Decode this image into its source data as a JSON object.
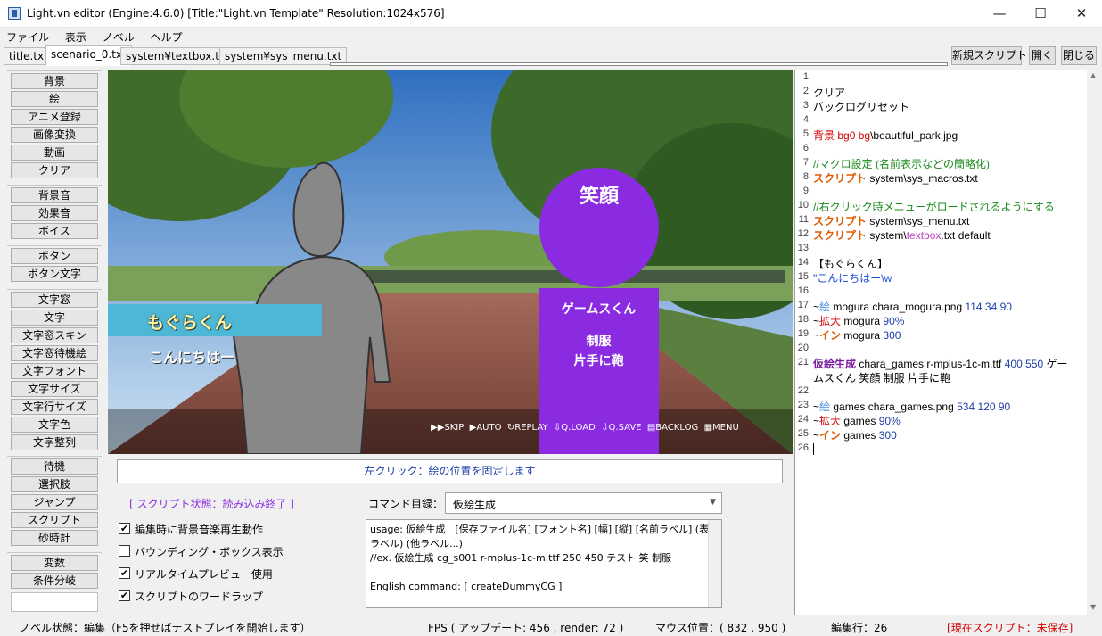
{
  "window": {
    "title": "Light.vn editor (Engine:4.6.0) [Title:\"Light.vn Template\" Resolution:1024x576]",
    "minimize": "—",
    "maximize": "☐",
    "close": "✕"
  },
  "menu": [
    "ファイル",
    "表示",
    "ノベル",
    "ヘルプ"
  ],
  "tabs": [
    "title.txt",
    "scenario_0.txt",
    "system¥textbox.txt",
    "system¥sys_menu.txt"
  ],
  "toolbar": {
    "new_script": "新規スクリプト",
    "open": "開く",
    "close": "閉じる"
  },
  "left_groups": [
    [
      "背景",
      "絵",
      "アニメ登録",
      "画像変換",
      "動画",
      "クリア"
    ],
    [
      "背景音",
      "効果音",
      "ボイス"
    ],
    [
      "ボタン",
      "ボタン文字"
    ],
    [
      "文字窓",
      "文字",
      "文字窓スキン",
      "文字窓待機絵",
      "文字フォント",
      "文字サイズ",
      "文字行サイズ",
      "文字色",
      "文字整列"
    ],
    [
      "待機",
      "選択肢",
      "ジャンプ",
      "スクリプト",
      "砂時計"
    ],
    [
      "変数",
      "条件分岐"
    ]
  ],
  "preview": {
    "name": "もぐらくん",
    "dialogue": "こんにちはー",
    "placeholder_face": "笑顔",
    "placeholder_name": "ゲームスくん",
    "placeholder_clothes": "制服",
    "placeholder_item": "片手に鞄",
    "menu": [
      "SKIP",
      "AUTO",
      "REPLAY",
      "Q.LOAD",
      "Q.SAVE",
      "BACKLOG",
      "MENU"
    ]
  },
  "info_bar": "左クリック：絵の位置を固定します",
  "script_state": "[ スクリプト状態：読み込み終了 ]",
  "command_label": "コマンド目録：",
  "command_selected": "仮絵生成",
  "usage": {
    "line1": "usage: 仮絵生成　[保存ファイル名] [フォント名] [幅] [縦] [名前ラベル] (表情",
    "line2": "ラベル) (他ラベル...)",
    "line3": "//ex. 仮絵生成 cg_s001 r-mplus-1c-m.ttf 250 450 テスト 笑 制服",
    "line4": "English command: [ createDummyCG ]"
  },
  "options": [
    {
      "label": "編集時に背景音楽再生動作",
      "checked": true
    },
    {
      "label": "バウンディング・ボックス表示",
      "checked": false
    },
    {
      "label": "リアルタイムプレビュー使用",
      "checked": true
    },
    {
      "label": "スクリプトのワードラップ",
      "checked": true
    }
  ],
  "code_lines": [
    {
      "n": "1",
      "parts": []
    },
    {
      "n": "2",
      "parts": [
        [
          "クリア",
          "#000000"
        ]
      ]
    },
    {
      "n": "3",
      "parts": [
        [
          "バックログリセット",
          "#000000"
        ]
      ]
    },
    {
      "n": "4",
      "parts": []
    },
    {
      "n": "5",
      "parts": [
        [
          "背景 ",
          "#d40000"
        ],
        [
          "bg0 ",
          "#d40000"
        ],
        [
          "bg",
          "#d40000"
        ],
        [
          "\\beautiful_park.jpg",
          "#000000"
        ]
      ]
    },
    {
      "n": "6",
      "parts": []
    },
    {
      "n": "7",
      "parts": [
        [
          "//マクロ設定 (名前表示などの簡略化)",
          "#1a8a1a"
        ]
      ]
    },
    {
      "n": "8",
      "parts": [
        [
          "スクリプト",
          "#e05a00"
        ],
        [
          " system\\sys_macros.txt",
          "#000000"
        ]
      ]
    },
    {
      "n": "9",
      "parts": []
    },
    {
      "n": "10",
      "parts": [
        [
          "//右クリック時メニューがロードされるようにする",
          "#1a8a1a"
        ]
      ]
    },
    {
      "n": "11",
      "parts": [
        [
          "スクリプト",
          "#e05a00"
        ],
        [
          " system\\sys_menu.txt",
          "#000000"
        ]
      ]
    },
    {
      "n": "12",
      "parts": [
        [
          "スクリプト",
          "#e05a00"
        ],
        [
          " system\\",
          "#000000"
        ],
        [
          "textbox",
          "#c040c0"
        ],
        [
          ".txt default",
          "#000000"
        ]
      ]
    },
    {
      "n": "13",
      "parts": []
    },
    {
      "n": "14",
      "parts": [
        [
          "【もぐらくん】",
          "#000000"
        ]
      ]
    },
    {
      "n": "15",
      "parts": [
        [
          "\"こんにちはー\\w",
          "#1d4fd8"
        ]
      ]
    },
    {
      "n": "16",
      "parts": []
    },
    {
      "n": "17",
      "parts": [
        [
          "~",
          "#000000"
        ],
        [
          "絵",
          "#4a90e2"
        ],
        [
          " mogura chara_mogura.png ",
          "#000000"
        ],
        [
          "114 34 90",
          "#1d3fa8"
        ]
      ]
    },
    {
      "n": "18",
      "parts": [
        [
          "~",
          "#000000"
        ],
        [
          "拡大",
          "#d40000"
        ],
        [
          " mogura ",
          "#000000"
        ],
        [
          "90%",
          "#1d3fa8"
        ]
      ]
    },
    {
      "n": "19",
      "parts": [
        [
          "~",
          "#000000"
        ],
        [
          "イン",
          "#e05a00"
        ],
        [
          " mogura ",
          "#000000"
        ],
        [
          "300",
          "#1d3fa8"
        ]
      ]
    },
    {
      "n": "20",
      "parts": []
    },
    {
      "n": "21",
      "parts": [
        [
          "仮絵生成",
          "#7a1fa0"
        ],
        [
          " chara_games r-mplus-1c-m.ttf ",
          "#000000"
        ],
        [
          "400 550",
          "#1d3fa8"
        ],
        [
          " ゲー",
          "#000000"
        ]
      ]
    },
    {
      "n": "",
      "parts": [
        [
          "ムスくん 笑顔 制服 片手に鞄",
          "#000000"
        ]
      ]
    },
    {
      "n": "22",
      "parts": []
    },
    {
      "n": "23",
      "parts": [
        [
          "~",
          "#000000"
        ],
        [
          "絵",
          "#4a90e2"
        ],
        [
          " games chara_games.png ",
          "#000000"
        ],
        [
          "534 120 90",
          "#1d3fa8"
        ]
      ]
    },
    {
      "n": "24",
      "parts": [
        [
          "~",
          "#000000"
        ],
        [
          "拡大",
          "#d40000"
        ],
        [
          " games ",
          "#000000"
        ],
        [
          "90%",
          "#1d3fa8"
        ]
      ]
    },
    {
      "n": "25",
      "parts": [
        [
          "~",
          "#000000"
        ],
        [
          "イン",
          "#e05a00"
        ],
        [
          " games ",
          "#000000"
        ],
        [
          "300",
          "#1d3fa8"
        ]
      ]
    },
    {
      "n": "26",
      "parts": []
    }
  ],
  "status": {
    "novel": "ノベル状態：編集（F5を押せばテストプレイを開始します）",
    "fps": "FPS ( アップデート: 456 , render: 72 )",
    "mouse": "マウス位置：( 832 , 950 )",
    "line": "編集行：26",
    "current": "[現在スクリプト：未保存]"
  }
}
